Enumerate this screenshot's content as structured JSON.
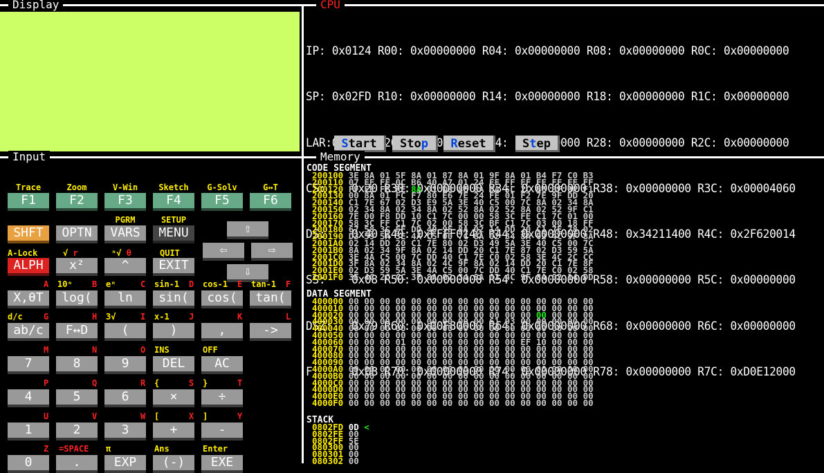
{
  "panels": {
    "display": "Display",
    "cpu": "CPU",
    "input": "Input",
    "memory": "Memory"
  },
  "colors": {
    "display_bg": "#ccff66",
    "cpu_title": "#ff2222",
    "address": "#ffee00",
    "highlight": "#22ee22",
    "fkey": "#66aa88",
    "shift": "#e8a040",
    "alpha": "#dd2222"
  },
  "cpu": {
    "rows": [
      "IP: 0x0124 R00: 0x00000000 R04: 0x00000000 R08: 0x00000000 R0C: 0x00000000",
      "SP: 0x02FD R10: 0x00000000 R14: 0x00000000 R18: 0x00000000 R1C: 0x00000000",
      "LAR:0x002C R20: 0x00000000 R24: 0x00000000 R28: 0x00000000 R2C: 0x00000000",
      "CS:    0x20 R30: 0x00000000 R34: 0x00000000 R38: 0x00000000 R3C: 0x00004060",
      "DS:    0x40 R40: 0xFFFF0140 R44: 0x00000000 R48: 0x34211400 R4C: 0x2F620014",
      "SS:    0x08 R50: 0x00000000 R54: 0x00000000 R58: 0x00000000 R5C: 0x00000000",
      "DSZ:   0x79 R60: 0x00F80000 R64: 0x00000000 R68: 0x00000000 R6C: 0x00000000",
      "F:     0x0B R70: 0x00000000 R74: 0x00000000 R78: 0x00000000 R7C: 0xD0E12000"
    ],
    "buttons": {
      "start": {
        "hotkey": "S",
        "rest": "tart"
      },
      "stop": {
        "pre": "Sto",
        "hotkey": "p"
      },
      "reset": {
        "hotkey": "R",
        "rest": "eset"
      },
      "step": {
        "pre": "S",
        "hotkey": "t",
        "rest": "ep"
      }
    }
  },
  "keypad": {
    "rows": [
      {
        "labels": [
          {
            "t": "Trace",
            "c": "y"
          },
          {
            "t": "Zoom",
            "c": "y"
          },
          {
            "t": "V-Win",
            "c": "y"
          },
          {
            "t": "Sketch",
            "c": "y"
          },
          {
            "t": "G-Solv",
            "c": "y"
          },
          {
            "t": "G↔T",
            "c": "y"
          }
        ],
        "keys": [
          "F1",
          "F2",
          "F3",
          "F4",
          "F5",
          "F6"
        ]
      },
      {
        "keys": [
          "SHFT",
          "OPTN",
          "VARS",
          "MENU"
        ],
        "above": [
          "",
          "",
          "PGRM",
          "SETUP"
        ]
      },
      {
        "keys": [
          "ALPH",
          "x²",
          "^",
          "EXIT"
        ],
        "above": [
          "A-Lock",
          "√  r",
          "ⁿ√  θ",
          "QUIT"
        ]
      },
      {
        "keys": [
          "X,θT",
          "log(",
          "ln",
          "sin(",
          "cos(",
          "tan("
        ],
        "above_y": [
          "",
          "10ⁿ",
          "eⁿ",
          "sin-1",
          "cos-1",
          "tan-1"
        ],
        "above_r": [
          "A",
          "B",
          "C",
          "D",
          "E",
          "F"
        ]
      },
      {
        "keys": [
          "ab/c",
          "F↔D",
          "(",
          ")",
          ",",
          "->"
        ],
        "above_y": [
          "d/c",
          "",
          "3√",
          "x-1",
          "",
          ""
        ],
        "above_r": [
          "G",
          "H",
          "I",
          "J",
          "K",
          "L"
        ]
      },
      {
        "keys": [
          "7",
          "8",
          "9",
          "DEL",
          "AC"
        ],
        "above_y": [
          "",
          "",
          "",
          "INS",
          "OFF"
        ],
        "above_r": [
          "M",
          "N",
          "O",
          "",
          ""
        ]
      },
      {
        "keys": [
          "4",
          "5",
          "6",
          "×",
          "÷"
        ],
        "above_y": [
          "",
          "",
          "",
          "{",
          "}"
        ],
        "above_r": [
          "P",
          "Q",
          "R",
          "S",
          "T"
        ]
      },
      {
        "keys": [
          "1",
          "2",
          "3",
          "+",
          "-"
        ],
        "above_y": [
          "",
          "",
          "",
          "[",
          "]"
        ],
        "above_r": [
          "U",
          "V",
          "W",
          "X",
          "Y"
        ]
      },
      {
        "keys": [
          "0",
          ".",
          "EXP",
          "(-)",
          "EXE"
        ],
        "above_y": [
          "",
          "",
          "π",
          "Ans",
          "Enter"
        ],
        "above_r": [
          "Z",
          "=SPACE",
          "",
          "",
          ""
        ]
      }
    ],
    "arrows": {
      "up": "⇧",
      "left": "⇦",
      "right": "⇨",
      "down": "⇩"
    }
  },
  "memory": {
    "code_title": "CODE SEGMENT",
    "code": [
      [
        "200100",
        "3E 8A 01 5F 8A 01 87 8A 01 9F 8A 01 B4 F7 C0 B3"
      ],
      [
        "200110",
        "07 FF FF 0C B6 40 A7 01 24 FF FF FF FF FF FF FF"
      ],
      [
        "200120",
        "FF FE FE FE 8A 01 D8 8E 8A 0A 5C 2C B6 BF 9F F1"
      ],
      [
        "200130",
        "00 8A 01 FC F7 80 E6 7E 24 FE 01 F2 7E 9F DD 20"
      ],
      [
        "200140",
        "C1 7E 67 02 D3 E9 5A 3E 40 C5 00 7C 8A 02 34 8A"
      ],
      [
        "200150",
        "02 34 8A 02 34 8A 02 52 8A 02 52 8A 02 52 9F C1"
      ],
      [
        "200160",
        "7E 00 F8 DD 10 C1 7C 00 00 58 3C FE C1 7C 01 00"
      ],
      [
        "200170",
        "58 3C FF C1 7C 02 00 58 3C BF C1 7C 03 00 18 FF"
      ],
      [
        "200180",
        "67 58 3C FF DD 40 9F 8A 02 14 DD 20 C1 7E 78 02"
      ],
      [
        "200190",
        "D3 59 5A 3E 4A C5 00 7C 8A 02 34 8A 02 4C 9F 8A"
      ],
      [
        "2001A0",
        "02 14 DD 20 C1 7E 80 02 D3 49 5A 3E 40 C5 00 7C"
      ],
      [
        "2001B0",
        "8A 02 34 9F 8A 02 14 DD 20 C1 7E 87 02 D3 59 5A"
      ],
      [
        "2001C0",
        "3E 4A C5 00 7C DD 40 C1 7E C0 02 58 3E 4C 2C CC"
      ],
      [
        "2001D0",
        "3F 8A 02 34 8A 02 4C 9F 8A 02 14 DD 20 C1 7E 8F"
      ],
      [
        "2001E0",
        "02 D3 59 5A 3E 4A C5 00 7C DD 40 C1 7E C0 02 58"
      ],
      [
        "2001F0",
        "3E 4C 2C CC 3F 8A 02 34 8A 02 4C 9F 8A 02 14 DD"
      ]
    ],
    "code_highlight": {
      "row": 2,
      "col": 4
    },
    "data_title": "DATA SEGMENT",
    "data": [
      [
        "400000",
        "00 00 00 00 00 00 00 00 00 00 00 00 00 00 00 00"
      ],
      [
        "400010",
        "00 00 00 00 00 00 00 00 00 00 00 00 00 00 00 00"
      ],
      [
        "400020",
        "00 00 00 00 00 00 00 00 00 00 00 00 00 00 00 00"
      ],
      [
        "400030",
        "00 00 00 00 00 00 00 00 00 61 93 00 00 00 00 00"
      ],
      [
        "400040",
        "00 00 00 00 00 00 00 00 00 00 00 00 00 00 00 00"
      ],
      [
        "400050",
        "00 00 00 00 00 00 00 00 00 00 00 00 00 00 00 00"
      ],
      [
        "400060",
        "00 00 00 01 00 00 00 00 00 00 00 EF 10 00 00 00"
      ],
      [
        "400070",
        "00 00 00 00 00 00 00 00 00 00 00 00 00 00 00 00"
      ],
      [
        "400080",
        "00 00 00 00 00 00 00 00 00 00 00 00 00 00 00 00"
      ],
      [
        "400090",
        "00 00 00 00 00 00 00 00 00 00 00 00 00 00 00 00"
      ],
      [
        "4000A0",
        "00 00 00 00 00 00 00 00 00 00 00 00 00 00 00 00"
      ],
      [
        "4000B0",
        "00 00 00 00 00 00 00 00 00 00 00 00 00 00 00 00"
      ],
      [
        "4000C0",
        "00 00 00 00 00 00 00 00 00 00 00 00 00 00 00 00"
      ],
      [
        "4000D0",
        "00 00 00 00 00 00 00 00 00 00 00 00 00 00 00 00"
      ],
      [
        "4000E0",
        "00 00 00 00 00 00 00 00 00 00 00 00 00 00 00 00"
      ],
      [
        "4000F0",
        "00 00 00 00 00 00 00 00 00 00 00 00 00 00 00 00"
      ]
    ],
    "data_highlight": {
      "row": 2,
      "col": 12
    },
    "stack_title": "STACK",
    "stack": [
      [
        "0802FD",
        "0D"
      ],
      [
        "0802FE",
        "00"
      ],
      [
        "0802FF",
        "5E"
      ],
      [
        "080300",
        "00"
      ],
      [
        "080301",
        "00"
      ],
      [
        "080302",
        "00"
      ]
    ],
    "stack_pointer_marker": "<"
  }
}
